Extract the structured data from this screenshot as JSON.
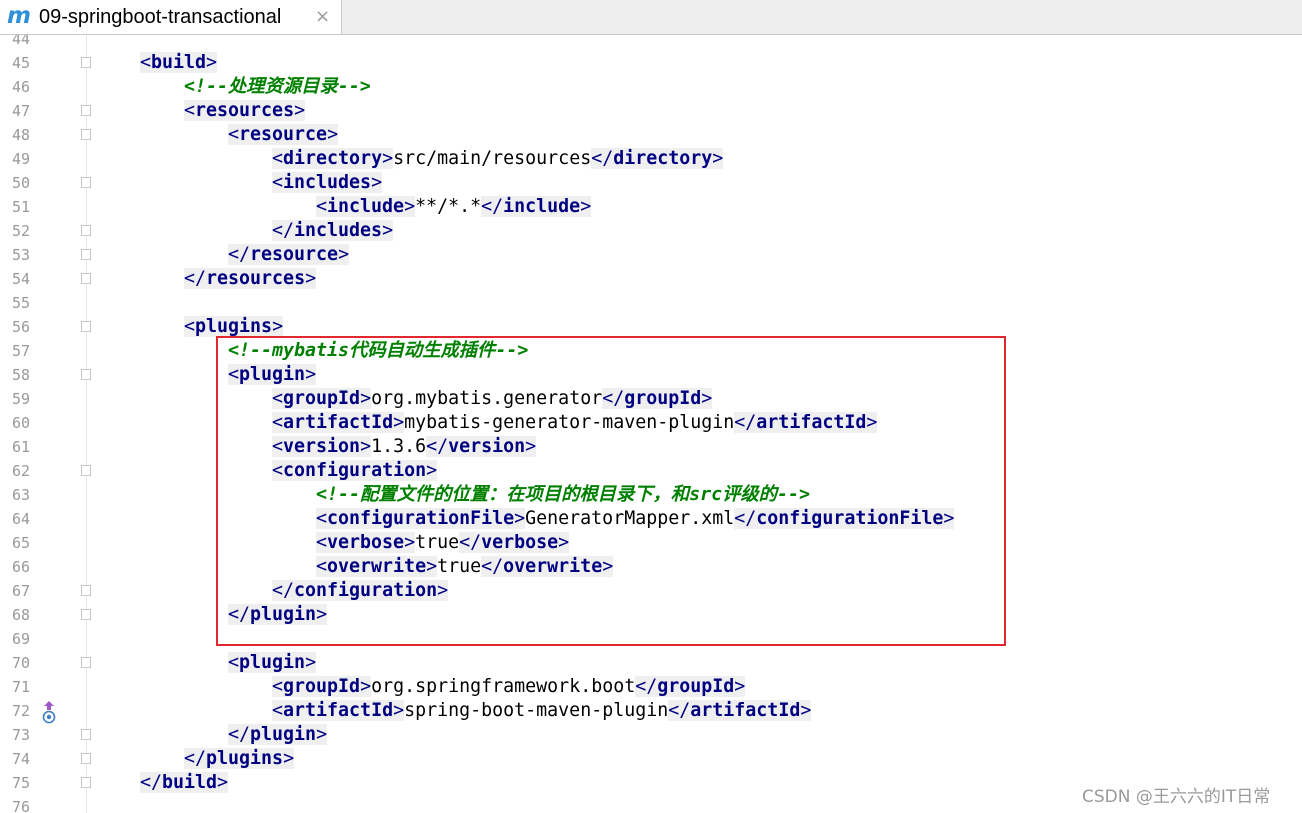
{
  "tab": {
    "icon": "maven-m-icon",
    "icon_text": "m",
    "title": "09-springboot-transactional",
    "close_glyph": "×"
  },
  "editor": {
    "lines": [
      {
        "num": "44",
        "indent": 0,
        "segments": []
      },
      {
        "num": "45",
        "indent": 1,
        "fold": true,
        "segments": [
          {
            "t": "tag",
            "open": true,
            "name": "build"
          }
        ]
      },
      {
        "num": "46",
        "indent": 2,
        "segments": [
          {
            "t": "cmt",
            "text": "<!--处理资源目录-->"
          }
        ]
      },
      {
        "num": "47",
        "indent": 2,
        "fold": true,
        "segments": [
          {
            "t": "tag",
            "open": true,
            "name": "resources"
          }
        ]
      },
      {
        "num": "48",
        "indent": 3,
        "fold": true,
        "segments": [
          {
            "t": "tag",
            "open": true,
            "name": "resource"
          }
        ]
      },
      {
        "num": "49",
        "indent": 4,
        "segments": [
          {
            "t": "tag",
            "open": true,
            "name": "directory"
          },
          {
            "t": "txt",
            "text": "src/main/resources"
          },
          {
            "t": "tag",
            "open": false,
            "name": "directory"
          }
        ]
      },
      {
        "num": "50",
        "indent": 4,
        "fold": true,
        "segments": [
          {
            "t": "tag",
            "open": true,
            "name": "includes"
          }
        ]
      },
      {
        "num": "51",
        "indent": 5,
        "segments": [
          {
            "t": "tag",
            "open": true,
            "name": "include"
          },
          {
            "t": "txt",
            "text": "**/*.*"
          },
          {
            "t": "tag",
            "open": false,
            "name": "include"
          }
        ]
      },
      {
        "num": "52",
        "indent": 4,
        "fold": true,
        "segments": [
          {
            "t": "tag",
            "open": false,
            "name": "includes"
          }
        ]
      },
      {
        "num": "53",
        "indent": 3,
        "fold": true,
        "segments": [
          {
            "t": "tag",
            "open": false,
            "name": "resource"
          }
        ]
      },
      {
        "num": "54",
        "indent": 2,
        "fold": true,
        "segments": [
          {
            "t": "tag",
            "open": false,
            "name": "resources"
          }
        ]
      },
      {
        "num": "55",
        "indent": 0,
        "segments": []
      },
      {
        "num": "56",
        "indent": 2,
        "fold": true,
        "segments": [
          {
            "t": "tag",
            "open": true,
            "name": "plugins"
          }
        ]
      },
      {
        "num": "57",
        "indent": 3,
        "segments": [
          {
            "t": "cmt",
            "text": "<!--mybatis代码自动生成插件-->"
          }
        ]
      },
      {
        "num": "58",
        "indent": 3,
        "fold": true,
        "segments": [
          {
            "t": "tag",
            "open": true,
            "name": "plugin"
          }
        ]
      },
      {
        "num": "59",
        "indent": 4,
        "segments": [
          {
            "t": "tag",
            "open": true,
            "name": "groupId"
          },
          {
            "t": "txt",
            "text": "org.mybatis.generator"
          },
          {
            "t": "tag",
            "open": false,
            "name": "groupId"
          }
        ]
      },
      {
        "num": "60",
        "indent": 4,
        "segments": [
          {
            "t": "tag",
            "open": true,
            "name": "artifactId"
          },
          {
            "t": "txt",
            "text": "mybatis-generator-maven-plugin"
          },
          {
            "t": "tag",
            "open": false,
            "name": "artifactId"
          }
        ]
      },
      {
        "num": "61",
        "indent": 4,
        "segments": [
          {
            "t": "tag",
            "open": true,
            "name": "version"
          },
          {
            "t": "txt",
            "text": "1.3.6"
          },
          {
            "t": "tag",
            "open": false,
            "name": "version"
          }
        ]
      },
      {
        "num": "62",
        "indent": 4,
        "fold": true,
        "segments": [
          {
            "t": "tag",
            "open": true,
            "name": "configuration"
          }
        ]
      },
      {
        "num": "63",
        "indent": 5,
        "segments": [
          {
            "t": "cmt",
            "text": "<!--配置文件的位置：在项目的根目录下，和src评级的-->"
          }
        ]
      },
      {
        "num": "64",
        "indent": 5,
        "segments": [
          {
            "t": "tag",
            "open": true,
            "name": "configurationFile"
          },
          {
            "t": "txt",
            "text": "GeneratorMapper.xml"
          },
          {
            "t": "tag",
            "open": false,
            "name": "configurationFile"
          }
        ]
      },
      {
        "num": "65",
        "indent": 5,
        "segments": [
          {
            "t": "tag",
            "open": true,
            "name": "verbose"
          },
          {
            "t": "txt",
            "text": "true"
          },
          {
            "t": "tag",
            "open": false,
            "name": "verbose"
          }
        ]
      },
      {
        "num": "66",
        "indent": 5,
        "segments": [
          {
            "t": "tag",
            "open": true,
            "name": "overwrite"
          },
          {
            "t": "txt",
            "text": "true"
          },
          {
            "t": "tag",
            "open": false,
            "name": "overwrite"
          }
        ]
      },
      {
        "num": "67",
        "indent": 4,
        "fold": true,
        "segments": [
          {
            "t": "tag",
            "open": false,
            "name": "configuration"
          }
        ]
      },
      {
        "num": "68",
        "indent": 3,
        "fold": true,
        "segments": [
          {
            "t": "tag",
            "open": false,
            "name": "plugin"
          }
        ]
      },
      {
        "num": "69",
        "indent": 0,
        "segments": []
      },
      {
        "num": "70",
        "indent": 3,
        "fold": true,
        "segments": [
          {
            "t": "tag",
            "open": true,
            "name": "plugin"
          }
        ]
      },
      {
        "num": "71",
        "indent": 4,
        "segments": [
          {
            "t": "tag",
            "open": true,
            "name": "groupId"
          },
          {
            "t": "txt",
            "text": "org.springframework.boot"
          },
          {
            "t": "tag",
            "open": false,
            "name": "groupId"
          }
        ]
      },
      {
        "num": "72",
        "indent": 4,
        "marker": true,
        "segments": [
          {
            "t": "tag",
            "open": true,
            "name": "artifactId"
          },
          {
            "t": "txt",
            "text": "spring-boot-maven-plugin"
          },
          {
            "t": "tag",
            "open": false,
            "name": "artifactId"
          }
        ]
      },
      {
        "num": "73",
        "indent": 3,
        "fold": true,
        "segments": [
          {
            "t": "tag",
            "open": false,
            "name": "plugin"
          }
        ]
      },
      {
        "num": "74",
        "indent": 2,
        "fold": true,
        "segments": [
          {
            "t": "tag",
            "open": false,
            "name": "plugins"
          }
        ]
      },
      {
        "num": "75",
        "indent": 1,
        "fold": true,
        "segments": [
          {
            "t": "tag",
            "open": false,
            "name": "build"
          }
        ]
      },
      {
        "num": "76",
        "indent": 0,
        "segments": []
      }
    ]
  },
  "gutter_marker": {
    "icon": "override-up-arrow-icon"
  },
  "watermark": "CSDN @王六六的IT日常",
  "colors": {
    "tag_fg": "#000080",
    "tag_bg": "#efefef",
    "comment": "#008000",
    "highlight_border": "#e0282e",
    "line_number": "#999999"
  }
}
